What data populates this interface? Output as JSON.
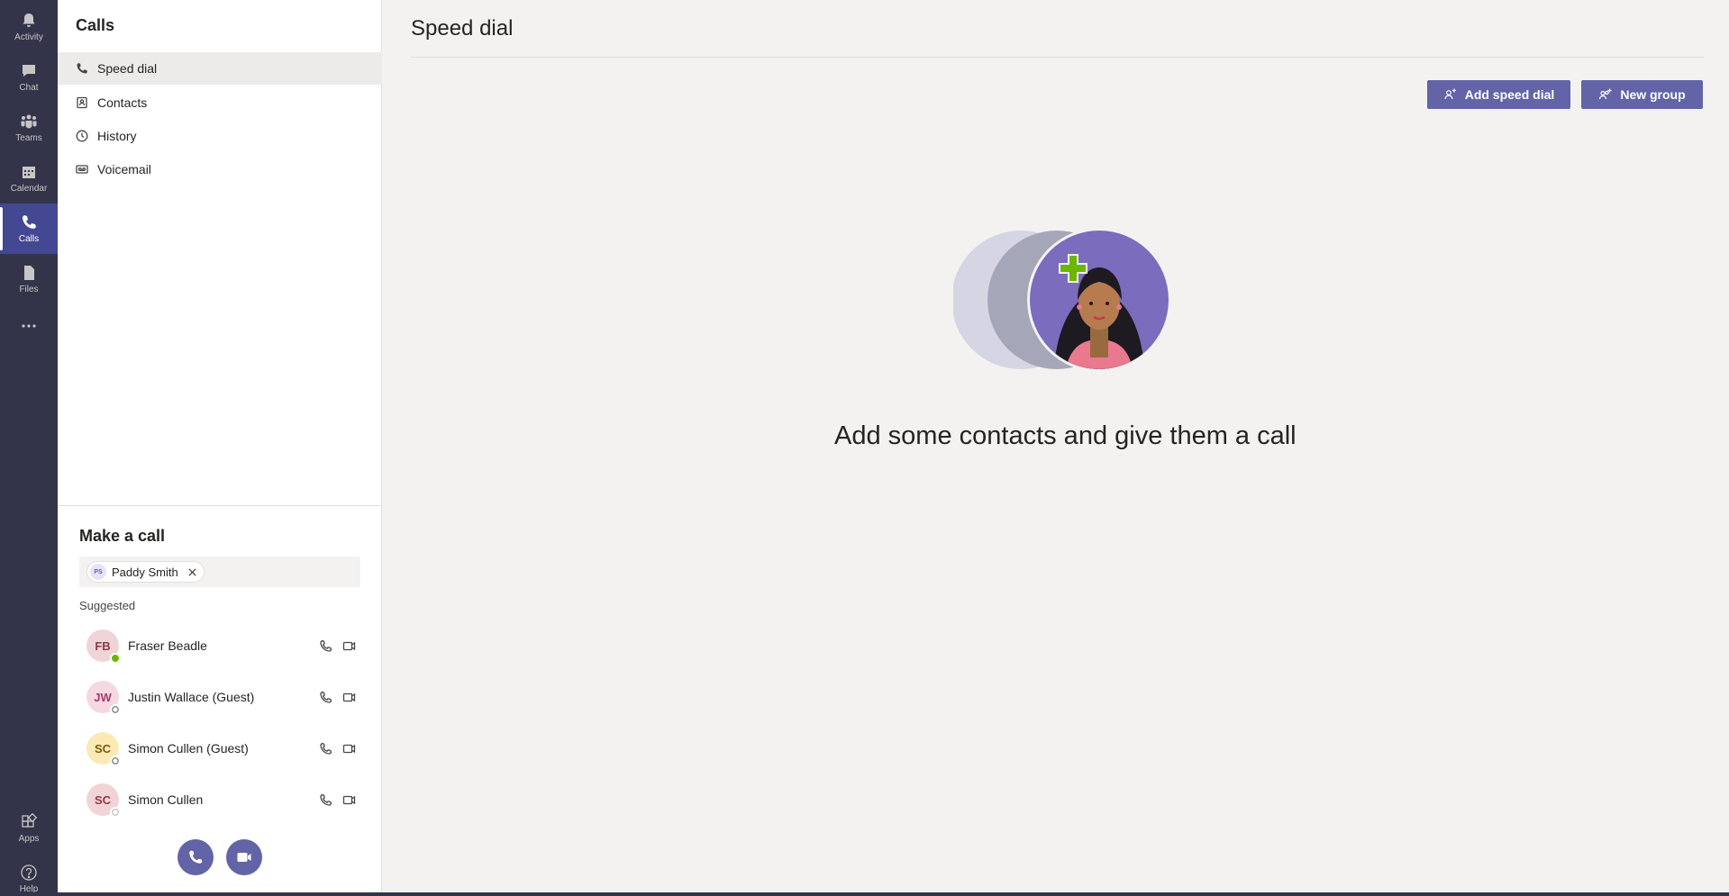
{
  "rail": {
    "items": [
      {
        "label": "Activity",
        "icon": "bell-icon"
      },
      {
        "label": "Chat",
        "icon": "chat-icon"
      },
      {
        "label": "Teams",
        "icon": "teams-icon"
      },
      {
        "label": "Calendar",
        "icon": "calendar-icon"
      },
      {
        "label": "Calls",
        "icon": "phone-icon",
        "active": true
      },
      {
        "label": "Files",
        "icon": "file-icon"
      },
      {
        "label": "",
        "icon": "more-icon"
      }
    ],
    "bottom": [
      {
        "label": "Apps",
        "icon": "apps-icon"
      },
      {
        "label": "Help",
        "icon": "help-icon"
      }
    ]
  },
  "panel": {
    "title": "Calls",
    "nav": [
      {
        "label": "Speed dial",
        "icon": "phone-icon",
        "active": true
      },
      {
        "label": "Contacts",
        "icon": "contacts-icon"
      },
      {
        "label": "History",
        "icon": "clock-icon"
      },
      {
        "label": "Voicemail",
        "icon": "voicemail-icon"
      }
    ],
    "make_call": {
      "title": "Make a call",
      "recipient": {
        "initials": "PS",
        "name": "Paddy Smith"
      },
      "suggested_label": "Suggested",
      "contacts": [
        {
          "initials": "FB",
          "name": "Fraser Beadle",
          "avatar_bg": "#f0d4d8",
          "avatar_fg": "#8b3a4a",
          "presence": "available"
        },
        {
          "initials": "JW",
          "name": "Justin Wallace (Guest)",
          "avatar_bg": "#f6d8e2",
          "avatar_fg": "#a33e6a",
          "presence": "offline"
        },
        {
          "initials": "SC",
          "name": "Simon Cullen (Guest)",
          "avatar_bg": "#fbeab5",
          "avatar_fg": "#7a5b00",
          "presence": "offline"
        },
        {
          "initials": "SC",
          "name": "Simon Cullen",
          "avatar_bg": "#f0d4d8",
          "avatar_fg": "#8b3a4a",
          "presence": "unknown"
        }
      ]
    }
  },
  "main": {
    "title": "Speed dial",
    "add_speed_dial_label": "Add speed dial",
    "new_group_label": "New group",
    "empty_message": "Add some contacts and give them a call"
  },
  "colors": {
    "rail_bg": "#33344a",
    "brand": "#6264a7",
    "available": "#6bb700"
  }
}
